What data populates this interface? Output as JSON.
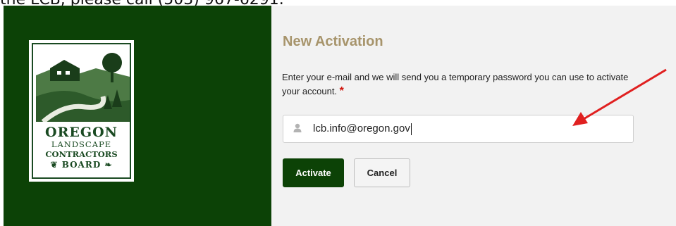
{
  "header": {
    "partial_text": "the LCB, please call (503) 967-6291."
  },
  "logo": {
    "line1": "OREGON",
    "line2": "LANDSCAPE",
    "line3": "CONTRACTORS",
    "line4": "BOARD"
  },
  "form": {
    "title": "New Activation",
    "description": "Enter your e-mail and we will send you a temporary password you can use to activate your account.",
    "required_mark": "*",
    "email_value": "lcb.info@oregon.gov",
    "activate_label": "Activate",
    "cancel_label": "Cancel"
  },
  "colors": {
    "panel_green": "#0c4206",
    "title_tan": "#a7946b",
    "required_red": "#d0140c",
    "arrow_red": "#e02020"
  },
  "icons": {
    "field_icon": "user-icon"
  }
}
